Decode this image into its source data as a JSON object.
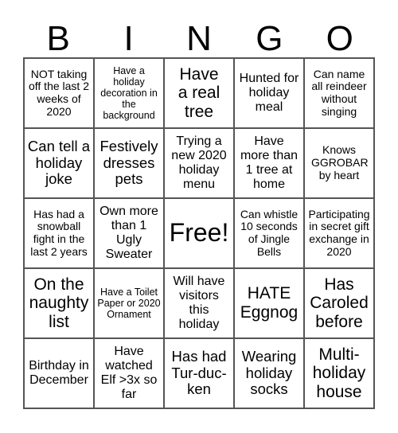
{
  "header": {
    "letters": [
      "B",
      "I",
      "N",
      "G",
      "O"
    ]
  },
  "card": {
    "rows": [
      [
        {
          "text": "NOT taking off the last 2 weeks of 2020"
        },
        {
          "text": "Have a holiday decoration in the background"
        },
        {
          "text": "Have a real tree"
        },
        {
          "text": "Hunted for holiday meal"
        },
        {
          "text": "Can name all reindeer without singing"
        }
      ],
      [
        {
          "text": "Can tell a holiday joke"
        },
        {
          "text": "Festively dresses pets"
        },
        {
          "text": "Trying a new 2020 holiday menu"
        },
        {
          "text": "Have more than 1 tree at home"
        },
        {
          "text": "Knows GGROBAR by heart"
        }
      ],
      [
        {
          "text": "Has had a snowball fight in the last 2 years"
        },
        {
          "text": "Own more than 1 Ugly Sweater"
        },
        {
          "text": "Free!"
        },
        {
          "text": "Can whistle 10 seconds of Jingle Bells"
        },
        {
          "text": "Participating in secret gift exchange in 2020"
        }
      ],
      [
        {
          "text": "On the naughty list"
        },
        {
          "text": "Have a Toilet Paper or 2020 Ornament"
        },
        {
          "text": "Will have visitors this holiday"
        },
        {
          "text": "HATE Eggnog"
        },
        {
          "text": "Has Caroled before"
        }
      ],
      [
        {
          "text": "Birthday in December"
        },
        {
          "text": "Have watched Elf >3x so far"
        },
        {
          "text": "Has had Tur-duc-ken"
        },
        {
          "text": "Wearing holiday socks"
        },
        {
          "text": "Multi-holiday house"
        }
      ]
    ]
  }
}
